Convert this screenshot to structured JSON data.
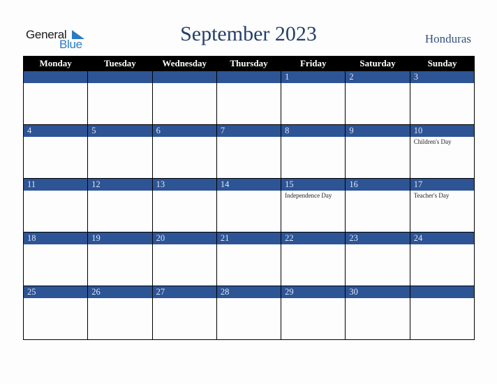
{
  "logo": {
    "line1": "General",
    "line2": "Blue"
  },
  "title": "September 2023",
  "country": "Honduras",
  "colors": {
    "title": "#253f6a",
    "day_bar": "#2d5495",
    "header_bg": "#000000",
    "logo_blue": "#2b7bc2"
  },
  "weekdays": [
    "Monday",
    "Tuesday",
    "Wednesday",
    "Thursday",
    "Friday",
    "Saturday",
    "Sunday"
  ],
  "weeks": [
    [
      {
        "day": "",
        "event": ""
      },
      {
        "day": "",
        "event": ""
      },
      {
        "day": "",
        "event": ""
      },
      {
        "day": "",
        "event": ""
      },
      {
        "day": "1",
        "event": ""
      },
      {
        "day": "2",
        "event": ""
      },
      {
        "day": "3",
        "event": ""
      }
    ],
    [
      {
        "day": "4",
        "event": ""
      },
      {
        "day": "5",
        "event": ""
      },
      {
        "day": "6",
        "event": ""
      },
      {
        "day": "7",
        "event": ""
      },
      {
        "day": "8",
        "event": ""
      },
      {
        "day": "9",
        "event": ""
      },
      {
        "day": "10",
        "event": "Children's Day"
      }
    ],
    [
      {
        "day": "11",
        "event": ""
      },
      {
        "day": "12",
        "event": ""
      },
      {
        "day": "13",
        "event": ""
      },
      {
        "day": "14",
        "event": ""
      },
      {
        "day": "15",
        "event": "Independence Day"
      },
      {
        "day": "16",
        "event": ""
      },
      {
        "day": "17",
        "event": "Teacher's Day"
      }
    ],
    [
      {
        "day": "18",
        "event": ""
      },
      {
        "day": "19",
        "event": ""
      },
      {
        "day": "20",
        "event": ""
      },
      {
        "day": "21",
        "event": ""
      },
      {
        "day": "22",
        "event": ""
      },
      {
        "day": "23",
        "event": ""
      },
      {
        "day": "24",
        "event": ""
      }
    ],
    [
      {
        "day": "25",
        "event": ""
      },
      {
        "day": "26",
        "event": ""
      },
      {
        "day": "27",
        "event": ""
      },
      {
        "day": "28",
        "event": ""
      },
      {
        "day": "29",
        "event": ""
      },
      {
        "day": "30",
        "event": ""
      },
      {
        "day": "",
        "event": ""
      }
    ]
  ]
}
